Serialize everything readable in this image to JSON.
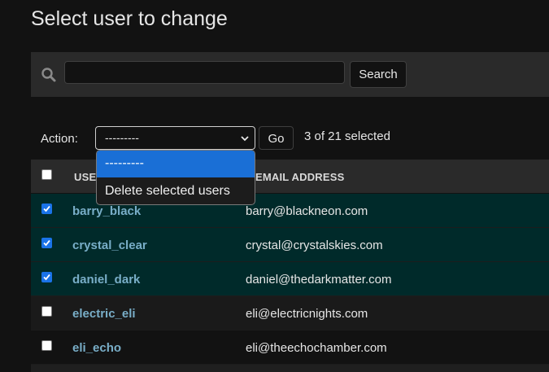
{
  "page": {
    "title": "Select user to change"
  },
  "search": {
    "placeholder": "",
    "value": "",
    "button_label": "Search"
  },
  "actions": {
    "label": "Action:",
    "selected": "---------",
    "options": [
      "---------",
      "Delete selected users"
    ],
    "go_label": "Go",
    "selection_count": "3 of 21 selected"
  },
  "table": {
    "columns": [
      "USERNAME",
      "EMAIL ADDRESS"
    ],
    "header_username_visible": "USE",
    "rows": [
      {
        "username": "barry_black",
        "email": "barry@blackneon.com",
        "checked": true
      },
      {
        "username": "crystal_clear",
        "email": "crystal@crystalskies.com",
        "checked": true
      },
      {
        "username": "daniel_dark",
        "email": "daniel@thedarkmatter.com",
        "checked": true
      },
      {
        "username": "electric_eli",
        "email": "eli@electricnights.com",
        "checked": false
      },
      {
        "username": "eli_echo",
        "email": "eli@theechochamber.com",
        "checked": false
      }
    ]
  },
  "colors": {
    "accent": "#79aec8",
    "selected_row": "#002a2a",
    "dropdown_highlight": "#1a6fd6",
    "checkbox_checked": "#1a73e8"
  },
  "icons": {
    "search": "search-icon",
    "select_chevron": "chevron-down-icon"
  }
}
